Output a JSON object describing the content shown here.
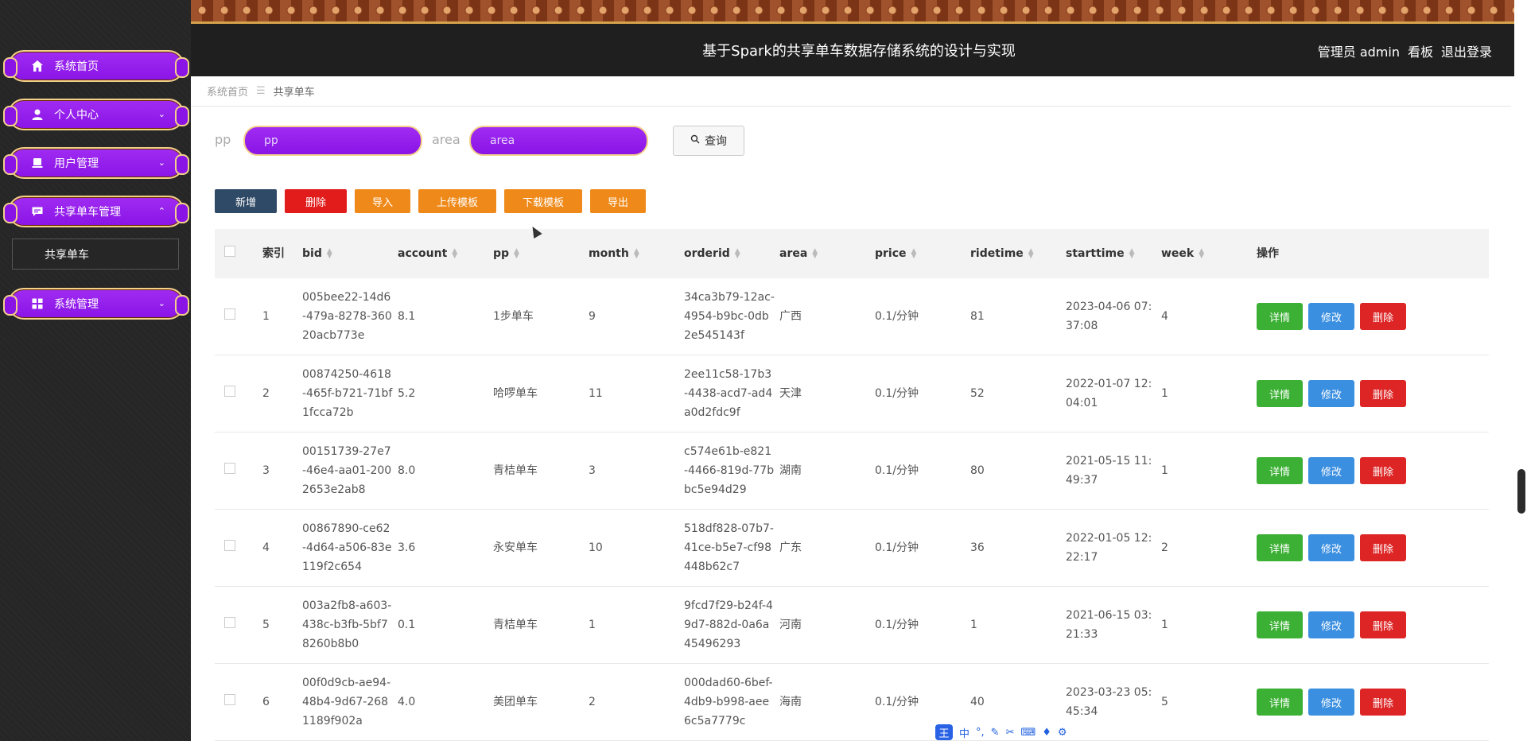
{
  "app": {
    "title": "基于Spark的共享单车数据存储系统的设计与实现",
    "user_label": "管理员 admin",
    "dashboard_link": "看板",
    "logout_link": "退出登录"
  },
  "sidebar": {
    "items": [
      {
        "label": "系统首页",
        "icon": "home-icon",
        "expanded": null
      },
      {
        "label": "个人中心",
        "icon": "person-icon",
        "expanded": false
      },
      {
        "label": "用户管理",
        "icon": "user-manage-icon",
        "expanded": false
      },
      {
        "label": "共享单车管理",
        "icon": "chat-icon",
        "expanded": true
      },
      {
        "label": "系统管理",
        "icon": "grid-icon",
        "expanded": false
      }
    ],
    "submenu": {
      "label": "共享单车"
    }
  },
  "breadcrumb": {
    "home": "系统首页",
    "current": "共享单车"
  },
  "search": {
    "pp_label": "pp",
    "pp_placeholder": "pp",
    "area_label": "area",
    "area_placeholder": "area",
    "query_button": "查询"
  },
  "actions": {
    "add": "新增",
    "delete": "删除",
    "import": "导入",
    "upload_template": "上传模板",
    "download_template": "下载模板",
    "export": "导出"
  },
  "table": {
    "headers": {
      "index": "索引",
      "bid": "bid",
      "account": "account",
      "pp": "pp",
      "month": "month",
      "orderid": "orderid",
      "area": "area",
      "price": "price",
      "ridetime": "ridetime",
      "starttime": "starttime",
      "week": "week",
      "ops": "操作"
    },
    "row_buttons": {
      "detail": "详情",
      "edit": "修改",
      "delete": "删除"
    },
    "rows": [
      {
        "index": "1",
        "bid": "005bee22-14d6-479a-8278-36020acb773e",
        "account": "8.1",
        "pp": "1步单车",
        "month": "9",
        "orderid": "34ca3b79-12ac-4954-b9bc-0db2e545143f",
        "area": "广西",
        "price": "0.1/分钟",
        "ridetime": "81",
        "starttime": "2023-04-06 07:37:08",
        "week": "4"
      },
      {
        "index": "2",
        "bid": "00874250-4618-465f-b721-71bf1fcca72b",
        "account": "5.2",
        "pp": "哈啰单车",
        "month": "11",
        "orderid": "2ee11c58-17b3-4438-acd7-ad4a0d2fdc9f",
        "area": "天津",
        "price": "0.1/分钟",
        "ridetime": "52",
        "starttime": "2022-01-07 12:04:01",
        "week": "1"
      },
      {
        "index": "3",
        "bid": "00151739-27e7-46e4-aa01-2002653e2ab8",
        "account": "8.0",
        "pp": "青桔单车",
        "month": "3",
        "orderid": "c574e61b-e821-4466-819d-77bbc5e94d29",
        "area": "湖南",
        "price": "0.1/分钟",
        "ridetime": "80",
        "starttime": "2021-05-15 11:49:37",
        "week": "1"
      },
      {
        "index": "4",
        "bid": "00867890-ce62-4d64-a506-83e119f2c654",
        "account": "3.6",
        "pp": "永安单车",
        "month": "10",
        "orderid": "518df828-07b7-41ce-b5e7-cf98448b62c7",
        "area": "广东",
        "price": "0.1/分钟",
        "ridetime": "36",
        "starttime": "2022-01-05 12:22:17",
        "week": "2"
      },
      {
        "index": "5",
        "bid": "003a2fb8-a603-438c-b3fb-5bf78260b8b0",
        "account": "0.1",
        "pp": "青桔单车",
        "month": "1",
        "orderid": "9fcd7f29-b24f-49d7-882d-0a6a45496293",
        "area": "河南",
        "price": "0.1/分钟",
        "ridetime": "1",
        "starttime": "2021-06-15 03:21:33",
        "week": "1"
      },
      {
        "index": "6",
        "bid": "00f0d9cb-ae94-48b4-9d67-2681189f902a",
        "account": "4.0",
        "pp": "美团单车",
        "month": "2",
        "orderid": "000dad60-6bef-4db9-b998-aee6c5a7779c",
        "area": "海南",
        "price": "0.1/分钟",
        "ridetime": "40",
        "starttime": "2023-03-23 05:45:34",
        "week": "5"
      }
    ]
  },
  "ime": {
    "logo": "王",
    "lang": "中",
    "punct": "°,"
  },
  "colors": {
    "sidebar_bg": "#262626",
    "menu_purple": "#8a14e6",
    "menu_border": "#f3d18a",
    "navy": "#2f4a66",
    "red": "#e21b1b",
    "orange": "#ef8a1a",
    "green": "#3cb035",
    "blue": "#3b8fe0"
  }
}
